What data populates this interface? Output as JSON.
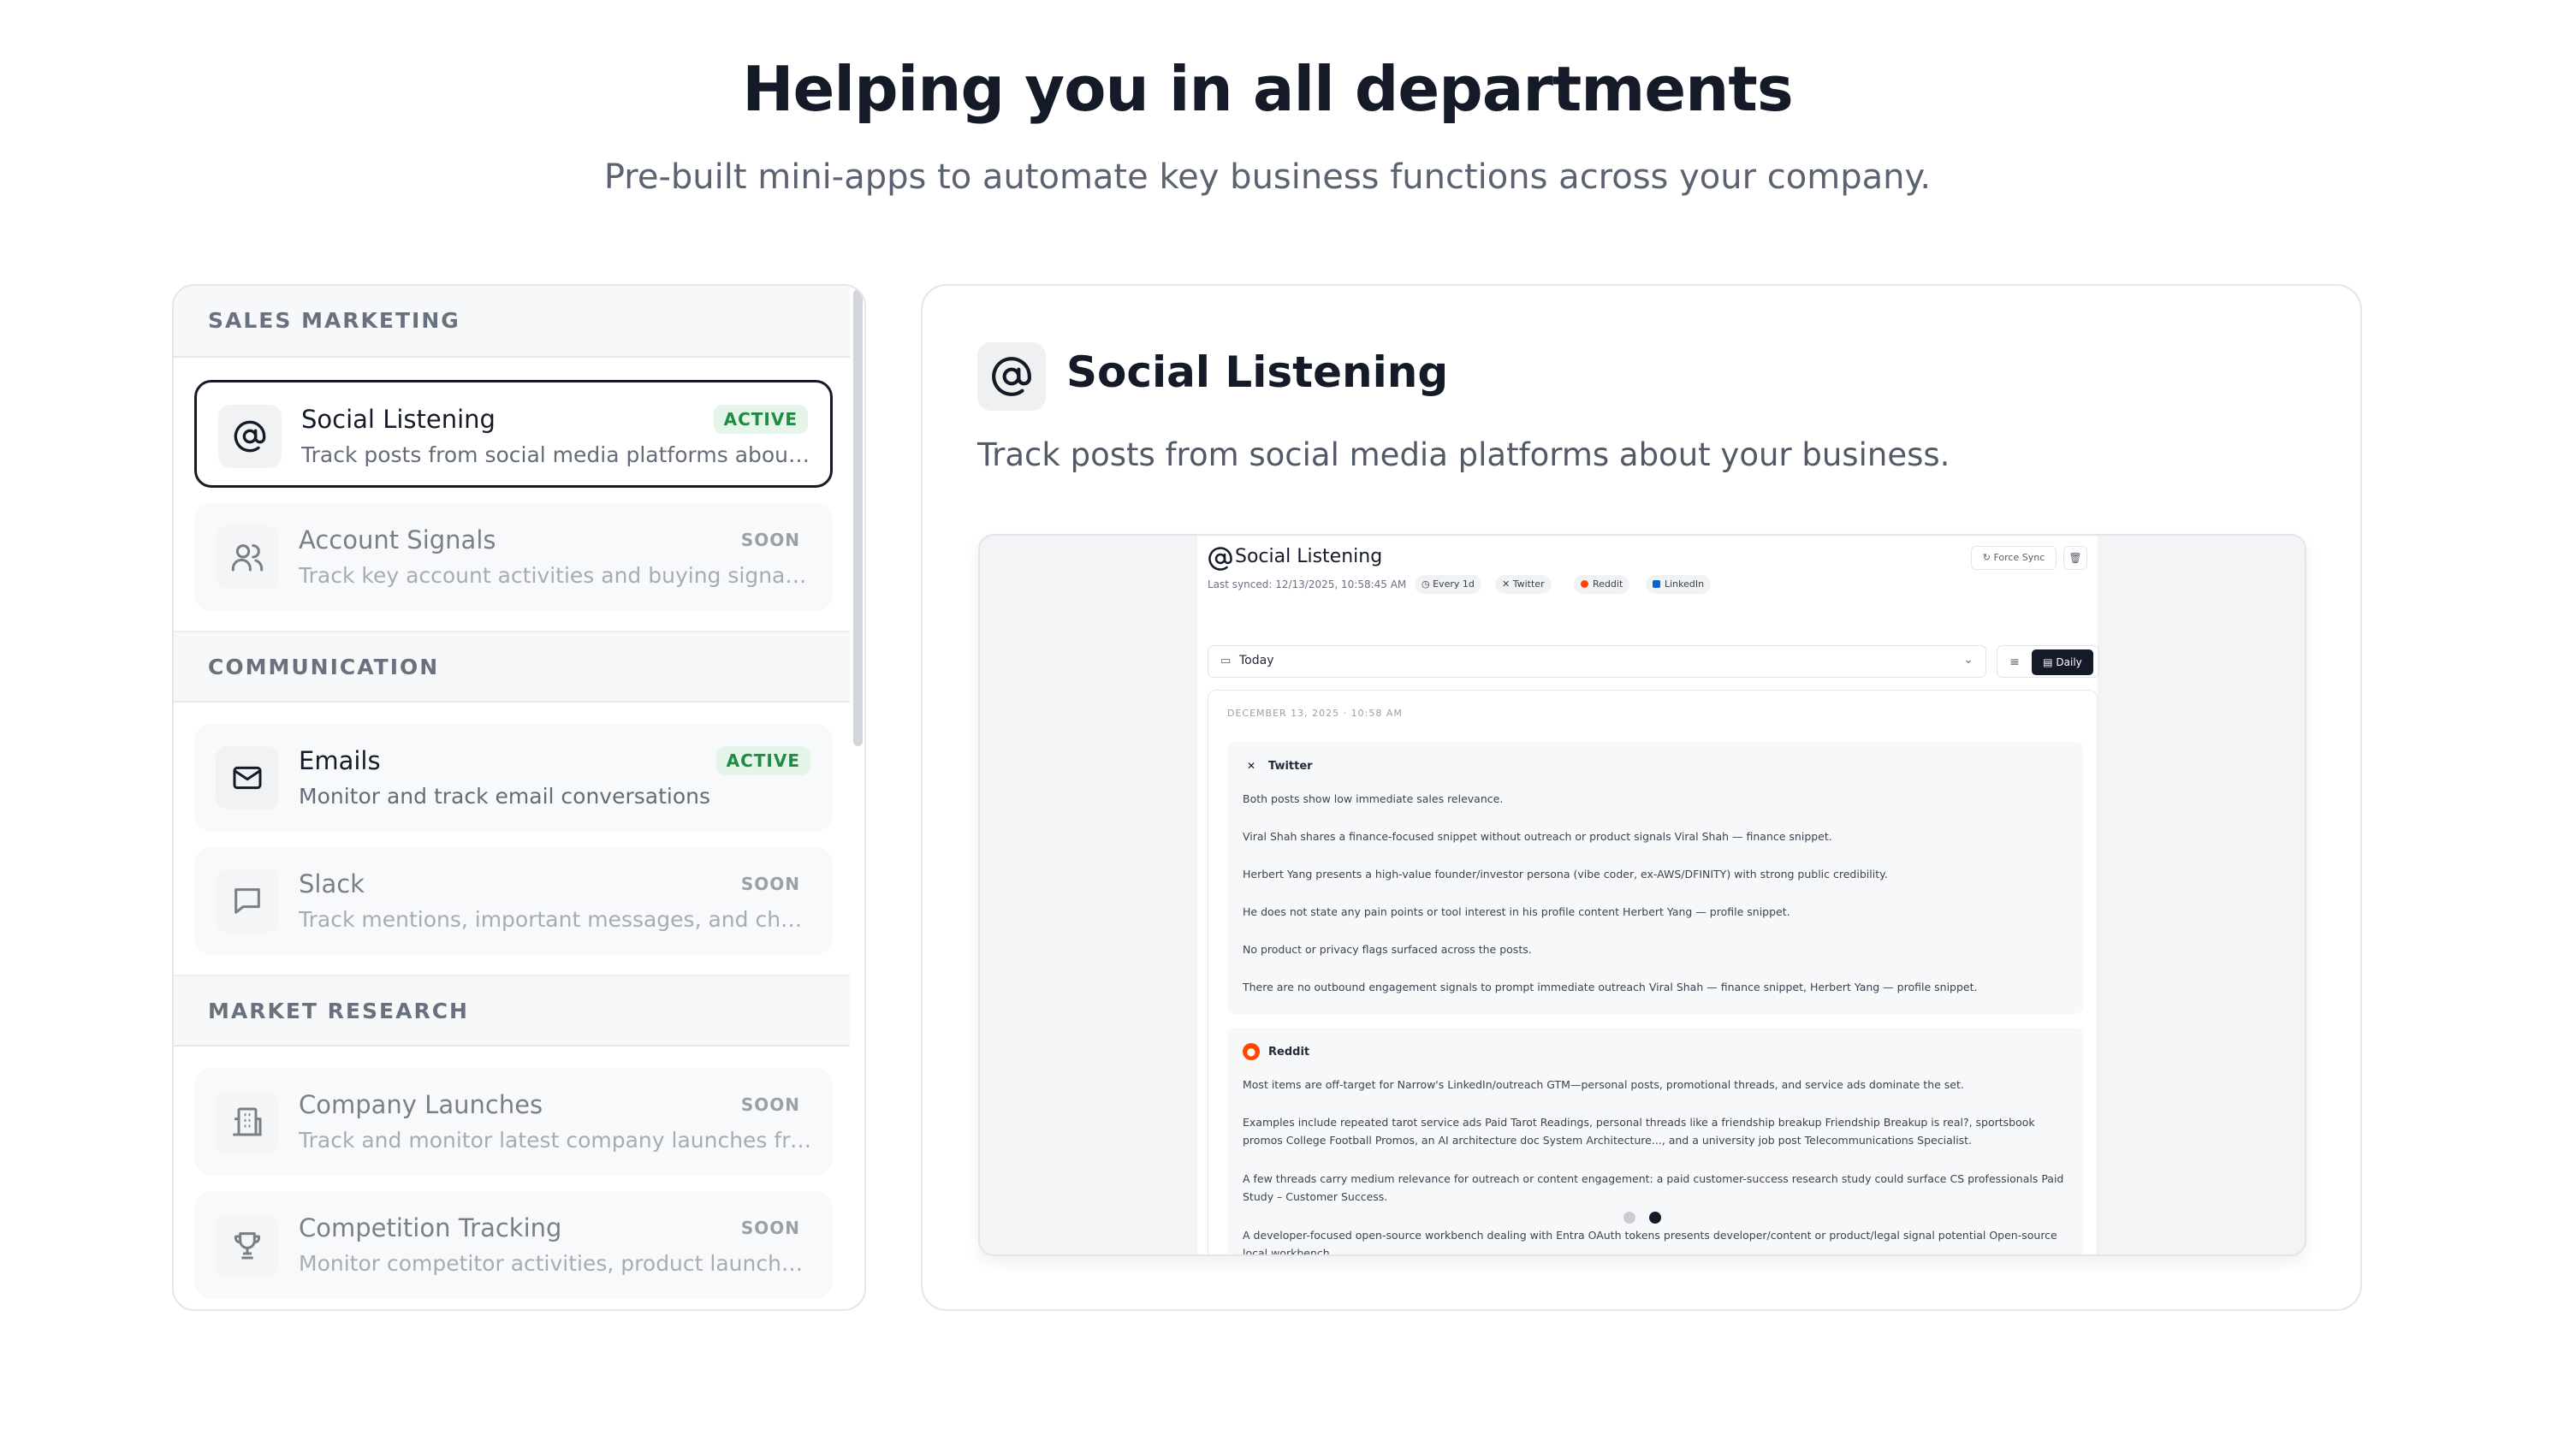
{
  "hero": {
    "title": "Helping you in all departments",
    "subtitle": "Pre-built mini-apps to automate key business functions across your company."
  },
  "sections": [
    {
      "label": "SALES MARKETING",
      "items": [
        {
          "name": "Social Listening",
          "desc": "Track posts from social media platforms about your business.",
          "badge": "ACTIVE",
          "icon": "at-sign-icon"
        },
        {
          "name": "Account Signals",
          "desc": "Track key account activities and buying signals across your accounts.",
          "badge": "SOON",
          "icon": "users-icon"
        }
      ]
    },
    {
      "label": "COMMUNICATION",
      "items": [
        {
          "name": "Emails",
          "desc": "Monitor and track email conversations",
          "badge": "ACTIVE",
          "icon": "mail-icon"
        },
        {
          "name": "Slack",
          "desc": "Track mentions, important messages, and channel activity.",
          "badge": "SOON",
          "icon": "message-square-icon"
        }
      ]
    },
    {
      "label": "MARKET RESEARCH",
      "items": [
        {
          "name": "Company Launches",
          "desc": "Track and monitor latest company launches from across the web.",
          "badge": "SOON",
          "icon": "building-icon"
        },
        {
          "name": "Competition Tracking",
          "desc": "Monitor competitor activities, product launches, and pricing changes.",
          "badge": "SOON",
          "icon": "trophy-icon"
        }
      ]
    }
  ],
  "detail": {
    "title": "Social Listening",
    "description": "Track posts from social media platforms about your business."
  },
  "preview": {
    "title": "Social Listening",
    "force_sync": "Force Sync",
    "last_synced": "Last synced: 12/13/2025, 10:58:45 AM",
    "chips": [
      "Every 1d",
      "Twitter",
      "Reddit",
      "LinkedIn"
    ],
    "date_value": "Today",
    "daily_label": "Daily",
    "feed_date": "DECEMBER 13, 2025 · 10:58 AM",
    "twitter": {
      "source": "Twitter",
      "lines": [
        "Both posts show low immediate sales relevance.",
        "Viral Shah shares a finance-focused snippet without outreach or product signals Viral Shah — finance snippet.",
        "Herbert Yang presents a high-value founder/investor persona (vibe coder, ex-AWS/DFINITY) with strong public credibility.",
        "He does not state any pain points or tool interest in his profile content Herbert Yang — profile snippet.",
        "No product or privacy flags surfaced across the posts.",
        "There are no outbound engagement signals to prompt immediate outreach Viral Shah — finance snippet, Herbert Yang — profile snippet."
      ]
    },
    "reddit": {
      "source": "Reddit",
      "lines": [
        "Most items are off-target for Narrow's LinkedIn/outreach GTM—personal posts, promotional threads, and service ads dominate the set.",
        "Examples include repeated tarot service ads Paid Tarot Readings, personal threads like a friendship breakup Friendship Breakup is real?, sportsbook promos College Football Promos, an AI architecture doc System Architecture..., and a university job post Telecommunications Specialist.",
        "A few threads carry medium relevance for outreach or content engagement: a paid customer-success research study could surface CS professionals Paid Study – Customer Success.",
        "A developer-focused open-source workbench dealing with Entra OAuth tokens presents developer/content or product/legal signal potential Open-source local workbench."
      ]
    }
  },
  "colors": {
    "active_badge_bg": "#e6f5ea",
    "active_badge_text": "#1f8b43",
    "reddit_orange": "#ff4500",
    "linkedin_blue": "#0a66c2",
    "dark": "#141a27"
  }
}
